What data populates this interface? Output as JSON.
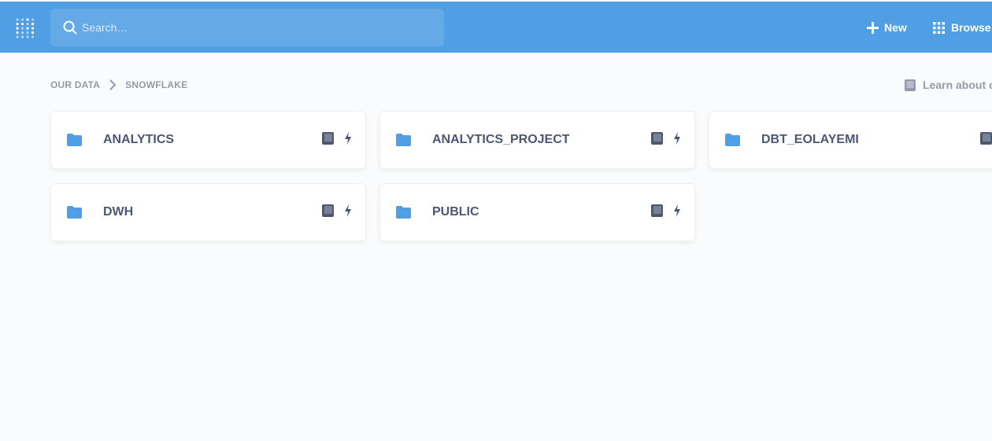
{
  "app": {
    "logo_icon": "metabase-logo-icon",
    "colors": {
      "brand": "#509ee3",
      "text_dark": "#4c5773",
      "text_muted": "#949aab",
      "background": "#f9fbfc"
    }
  },
  "header": {
    "search": {
      "placeholder": "Search…",
      "value": ""
    },
    "new_label": "New",
    "browse_label": "Browse data"
  },
  "breadcrumb": {
    "items": [
      "OUR DATA",
      "SNOWFLAKE"
    ]
  },
  "learn_link": "Learn about our data",
  "schemas": [
    {
      "name": "ANALYTICS"
    },
    {
      "name": "ANALYTICS_PROJECT"
    },
    {
      "name": "DBT_EOLAYEMI"
    },
    {
      "name": "DWH"
    },
    {
      "name": "PUBLIC"
    }
  ]
}
